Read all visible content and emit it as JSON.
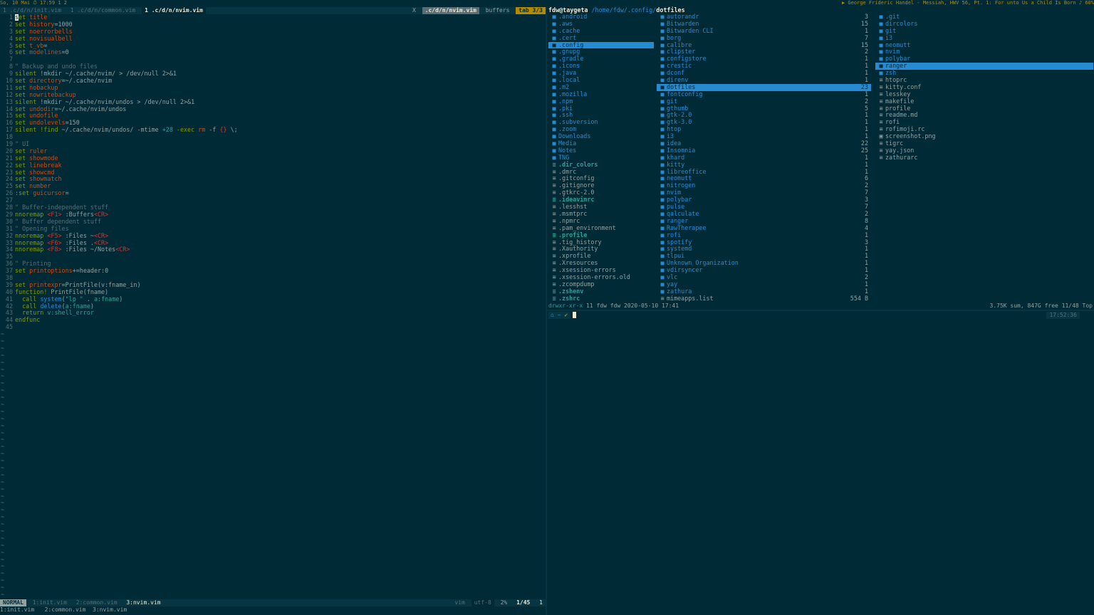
{
  "topbar": {
    "left": "So, 10 Mai ⏱ 17:59 1 2",
    "right": "▶ George Frideric Handel - Messiah, HWV 56, Pt. 1: For unto Us a Child Is Born ♪ 60%"
  },
  "vim": {
    "tabs": [
      "1 .c/d/n/init.vim",
      "1 .c/d/n/common.vim",
      "1 .c/d/n/nvim.vim"
    ],
    "tabs_right": {
      "close": "X",
      "current": ".c/d/n/nvim.vim",
      "buffers": "buffers",
      "tabcount": "tab 3/3"
    },
    "lines": [
      [
        [
          "kw",
          "set "
        ],
        [
          "id",
          "title"
        ]
      ],
      [
        [
          "kw",
          "set "
        ],
        [
          "id",
          "history"
        ],
        [
          "",
          "=1000"
        ]
      ],
      [
        [
          "kw",
          "set "
        ],
        [
          "id",
          "noerrorbells"
        ]
      ],
      [
        [
          "kw",
          "set "
        ],
        [
          "id",
          "novisualbell"
        ]
      ],
      [
        [
          "kw",
          "set "
        ],
        [
          "id",
          "t_vb"
        ],
        [
          "",
          "="
        ]
      ],
      [
        [
          "kw",
          "set "
        ],
        [
          "id",
          "modelines"
        ],
        [
          "",
          "=0"
        ]
      ],
      [
        [
          "",
          ""
        ]
      ],
      [
        [
          "cm",
          "\" Backup and undo files"
        ]
      ],
      [
        [
          "kw",
          "silent "
        ],
        [
          "",
          ""
        ],
        [
          "",
          "!mkdir ~/.cache/nvim/ > /dev/null 2>&1"
        ]
      ],
      [
        [
          "kw",
          "set "
        ],
        [
          "id",
          "directory"
        ],
        [
          "",
          "=~/.cache/nvim"
        ]
      ],
      [
        [
          "kw",
          "set "
        ],
        [
          "id",
          "nobackup"
        ]
      ],
      [
        [
          "kw",
          "set "
        ],
        [
          "id",
          "nowritebackup"
        ]
      ],
      [
        [
          "kw",
          "silent "
        ],
        [
          "",
          "!mkdir ~/.cache/nvim/undos > /dev/null 2>&1"
        ]
      ],
      [
        [
          "kw",
          "set "
        ],
        [
          "id",
          "undodir"
        ],
        [
          "",
          "=~/.cache/nvim/undos"
        ]
      ],
      [
        [
          "kw",
          "set "
        ],
        [
          "id",
          "undofile"
        ]
      ],
      [
        [
          "kw",
          "set "
        ],
        [
          "id",
          "undolevels"
        ],
        [
          "",
          "=150"
        ]
      ],
      [
        [
          "kw",
          "silent "
        ],
        [
          "kw",
          "!find "
        ],
        [
          "",
          "~/.cache/nvim/undos/ -mtime "
        ],
        [
          "st",
          "+28"
        ],
        [
          "",
          ""
        ],
        [
          "kw",
          " -exec "
        ],
        [
          "id",
          "rm "
        ],
        [
          "",
          "-f "
        ],
        [
          "sp",
          "{}"
        ],
        [
          "",
          " \\;"
        ]
      ],
      [
        [
          "",
          ""
        ]
      ],
      [
        [
          "cm",
          "\" UI"
        ]
      ],
      [
        [
          "kw",
          "set "
        ],
        [
          "id",
          "ruler"
        ]
      ],
      [
        [
          "kw",
          "set "
        ],
        [
          "id",
          "showmode"
        ]
      ],
      [
        [
          "kw",
          "set "
        ],
        [
          "id",
          "linebreak"
        ]
      ],
      [
        [
          "kw",
          "set "
        ],
        [
          "id",
          "showcmd"
        ]
      ],
      [
        [
          "kw",
          "set "
        ],
        [
          "id",
          "showmatch"
        ]
      ],
      [
        [
          "kw",
          "set "
        ],
        [
          "id",
          "number"
        ]
      ],
      [
        [
          "kw",
          ":set "
        ],
        [
          "id",
          "guicursor"
        ],
        [
          "",
          "="
        ]
      ],
      [
        [
          "",
          ""
        ]
      ],
      [
        [
          "cm",
          "\" Buffer-independent stuff"
        ]
      ],
      [
        [
          "kw",
          "nnoremap "
        ],
        [
          "sp",
          "<F1>"
        ],
        [
          "",
          " :Buffers"
        ],
        [
          "sp",
          "<CR>"
        ]
      ],
      [
        [
          "cm",
          "\" Buffer dependent stuff"
        ]
      ],
      [
        [
          "cm",
          "\" Opening files"
        ]
      ],
      [
        [
          "kw",
          "nnoremap "
        ],
        [
          "sp",
          "<F5>"
        ],
        [
          "",
          " :Files ~"
        ],
        [
          "sp",
          "<CR>"
        ]
      ],
      [
        [
          "kw",
          "nnoremap "
        ],
        [
          "sp",
          "<F6>"
        ],
        [
          "",
          " :Files ."
        ],
        [
          "sp",
          "<CR>"
        ]
      ],
      [
        [
          "kw",
          "nnoremap "
        ],
        [
          "sp",
          "<F8>"
        ],
        [
          "",
          " :Files ~/Notes"
        ],
        [
          "sp",
          "<CR>"
        ]
      ],
      [
        [
          "",
          ""
        ]
      ],
      [
        [
          "cm",
          "\" Printing"
        ]
      ],
      [
        [
          "kw",
          "set "
        ],
        [
          "id",
          "printoptions"
        ],
        [
          "",
          "+=header:0"
        ]
      ],
      [
        [
          "",
          ""
        ]
      ],
      [
        [
          "kw",
          "set "
        ],
        [
          "id",
          "printexpr"
        ],
        [
          "",
          "=PrintFile(v:fname_in)"
        ]
      ],
      [
        [
          "kw",
          "function! "
        ],
        [
          "",
          "PrintFile(fname)"
        ]
      ],
      [
        [
          "",
          "  "
        ],
        [
          "kw",
          "call "
        ],
        [
          "fn",
          "system"
        ],
        [
          "",
          "("
        ],
        [
          "st",
          "\"lp \""
        ],
        [
          "",
          " . "
        ],
        [
          "st",
          "a:fname"
        ],
        [
          "",
          ")"
        ]
      ],
      [
        [
          "",
          "  "
        ],
        [
          "kw",
          "call "
        ],
        [
          "fn",
          "delete"
        ],
        [
          "",
          "("
        ],
        [
          "st",
          "a:fname"
        ],
        [
          "",
          ")"
        ]
      ],
      [
        [
          "",
          "  "
        ],
        [
          "kw",
          "return "
        ],
        [
          "st",
          "v:shell_error"
        ]
      ],
      [
        [
          "kw",
          "endfunc"
        ]
      ],
      [
        [
          "",
          ""
        ]
      ]
    ],
    "tilde_count": 39,
    "status": {
      "mode": "NORMAL",
      "buffers": [
        "1:init.vim",
        "2:common.vim",
        "3:nvim.vim"
      ],
      "filetype": "vim",
      "encoding": "utf-8",
      "percent": "2%",
      "position": "1/45",
      "col": "1"
    },
    "cmdline": "1:init.vim   2:common.vim  3:nvim.vim"
  },
  "ranger": {
    "user": "fdw@taygeta",
    "path": "/home/fdw/.config/",
    "current": "dotfiles",
    "col1": [
      {
        "n": ".android",
        "t": "dir"
      },
      {
        "n": ".aws",
        "t": "dir"
      },
      {
        "n": ".cache",
        "t": "dir"
      },
      {
        "n": ".cert",
        "t": "dir"
      },
      {
        "n": ".config",
        "t": "dir",
        "sel": true
      },
      {
        "n": ".gnupg",
        "t": "dir"
      },
      {
        "n": ".gradle",
        "t": "dir"
      },
      {
        "n": ".icons",
        "t": "dir"
      },
      {
        "n": ".java",
        "t": "dir"
      },
      {
        "n": ".local",
        "t": "dir"
      },
      {
        "n": ".m2",
        "t": "dir"
      },
      {
        "n": ".mozilla",
        "t": "dir"
      },
      {
        "n": ".npm",
        "t": "dir"
      },
      {
        "n": ".pki",
        "t": "dir"
      },
      {
        "n": ".ssh",
        "t": "dir"
      },
      {
        "n": ".subversion",
        "t": "dir"
      },
      {
        "n": ".zoom",
        "t": "dir"
      },
      {
        "n": "Downloads",
        "t": "dir"
      },
      {
        "n": "Media",
        "t": "dir"
      },
      {
        "n": "Notes",
        "t": "dir"
      },
      {
        "n": "TNG",
        "t": "dir"
      },
      {
        "n": ".dir_colors",
        "t": "exe"
      },
      {
        "n": ".dmrc",
        "t": "file"
      },
      {
        "n": ".gitconfig",
        "t": "file"
      },
      {
        "n": ".gitignore",
        "t": "file"
      },
      {
        "n": ".gtkrc-2.0",
        "t": "file"
      },
      {
        "n": ".ideavimrc",
        "t": "exe"
      },
      {
        "n": ".lesshst",
        "t": "file"
      },
      {
        "n": ".msmtprc",
        "t": "file"
      },
      {
        "n": ".npmrc",
        "t": "file"
      },
      {
        "n": ".pam_environment",
        "t": "file"
      },
      {
        "n": ".profile",
        "t": "exe"
      },
      {
        "n": ".tig_history",
        "t": "file"
      },
      {
        "n": ".Xauthority",
        "t": "file"
      },
      {
        "n": ".xprofile",
        "t": "file"
      },
      {
        "n": ".Xresources",
        "t": "file"
      },
      {
        "n": ".xsession-errors",
        "t": "file"
      },
      {
        "n": ".xsession-errors.old",
        "t": "file"
      },
      {
        "n": ".zcompdump",
        "t": "file"
      },
      {
        "n": ".zshenv",
        "t": "exe"
      },
      {
        "n": ".zshrc",
        "t": "exe"
      }
    ],
    "col2": [
      {
        "n": "autorandr",
        "c": "3"
      },
      {
        "n": "Bitwarden",
        "c": "15"
      },
      {
        "n": "Bitwarden CLI",
        "c": "1"
      },
      {
        "n": "borg",
        "c": "7"
      },
      {
        "n": "calibre",
        "c": "15"
      },
      {
        "n": "clipster",
        "c": "2"
      },
      {
        "n": "configstore",
        "c": "1"
      },
      {
        "n": "crestic",
        "c": "1"
      },
      {
        "n": "dconf",
        "c": "1"
      },
      {
        "n": "direnv",
        "c": "1"
      },
      {
        "n": "dotfiles",
        "c": "23",
        "sel": true
      },
      {
        "n": "fontconfig",
        "c": "1"
      },
      {
        "n": "git",
        "c": "2"
      },
      {
        "n": "gthumb",
        "c": "5"
      },
      {
        "n": "gtk-2.0",
        "c": "1"
      },
      {
        "n": "gtk-3.0",
        "c": "1"
      },
      {
        "n": "htop",
        "c": "1"
      },
      {
        "n": "i3",
        "c": "1"
      },
      {
        "n": "idea",
        "c": "22"
      },
      {
        "n": "Insomnia",
        "c": "25"
      },
      {
        "n": "khard",
        "c": "1"
      },
      {
        "n": "kitty",
        "c": "1"
      },
      {
        "n": "libreoffice",
        "c": "1"
      },
      {
        "n": "neomutt",
        "c": "6"
      },
      {
        "n": "nitrogen",
        "c": "2"
      },
      {
        "n": "nvim",
        "c": "7"
      },
      {
        "n": "polybar",
        "c": "3"
      },
      {
        "n": "pulse",
        "c": "7"
      },
      {
        "n": "qalculate",
        "c": "2"
      },
      {
        "n": "ranger",
        "c": "8"
      },
      {
        "n": "RawTherapee",
        "c": "4"
      },
      {
        "n": "rofi",
        "c": "1"
      },
      {
        "n": "spotify",
        "c": "3"
      },
      {
        "n": "systemd",
        "c": "1"
      },
      {
        "n": "tlpui",
        "c": "1"
      },
      {
        "n": "Unknown Organization",
        "c": "1"
      },
      {
        "n": "vdirsyncer",
        "c": "1"
      },
      {
        "n": "vlc",
        "c": "2"
      },
      {
        "n": "yay",
        "c": "1"
      },
      {
        "n": "zathura",
        "c": "1"
      },
      {
        "n": "mimeapps.list",
        "c": "554 B",
        "file": true
      }
    ],
    "col3": [
      {
        "n": ".git",
        "t": "dir"
      },
      {
        "n": "dircolors",
        "t": "dir"
      },
      {
        "n": "git",
        "t": "dir"
      },
      {
        "n": "i3",
        "t": "dir"
      },
      {
        "n": "neomutt",
        "t": "dir"
      },
      {
        "n": "nvim",
        "t": "dir"
      },
      {
        "n": "polybar",
        "t": "dir"
      },
      {
        "n": "ranger",
        "t": "dir",
        "sel": true
      },
      {
        "n": "zsh",
        "t": "dir"
      },
      {
        "n": "htoprc",
        "t": "file"
      },
      {
        "n": "kitty.conf",
        "t": "file"
      },
      {
        "n": "lesskey",
        "t": "file"
      },
      {
        "n": "makefile",
        "t": "file"
      },
      {
        "n": "profile",
        "t": "file"
      },
      {
        "n": "readme.md",
        "t": "file"
      },
      {
        "n": "rofi",
        "t": "file"
      },
      {
        "n": "rofimoji.rc",
        "t": "file"
      },
      {
        "n": "screenshot.png",
        "t": "img"
      },
      {
        "n": "tigrc",
        "t": "file"
      },
      {
        "n": "yay.json",
        "t": "file"
      },
      {
        "n": "zathurarc",
        "t": "file"
      }
    ],
    "status": {
      "perm": "drwxr-xr-x",
      "info": " 11 fdw fdw 2020-05-10 17:41",
      "right": "3.75K sum, 847G free  11/48  Top"
    }
  },
  "shell": {
    "prompt_home": "~",
    "time": "17:52:36"
  },
  "colors": {
    "bg": "#002b36",
    "accent": "#268bd2",
    "keyword": "#859900",
    "identifier": "#cb4b16"
  }
}
